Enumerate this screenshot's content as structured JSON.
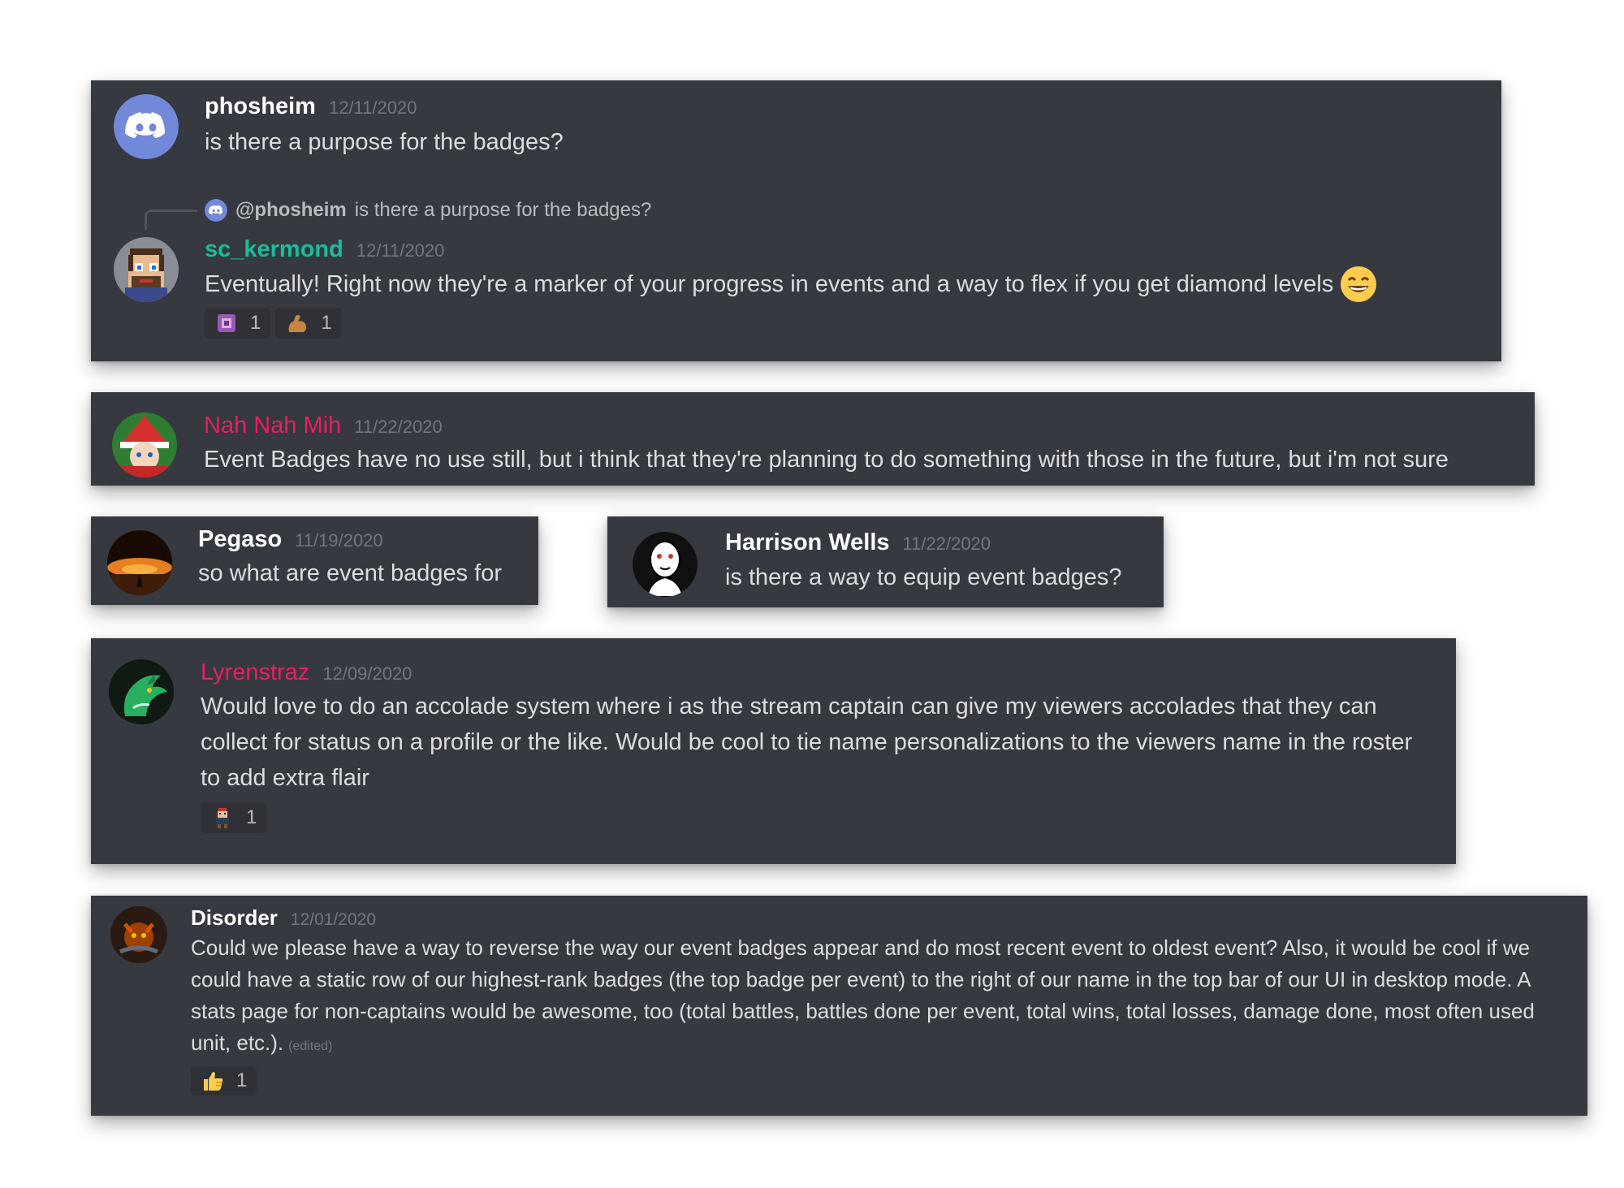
{
  "colors": {
    "card_bg": "#36393f",
    "username_default": "#ffffff",
    "username_teal": "#1abc9c",
    "username_pink": "#e91e63",
    "timestamp": "#72767d",
    "message_text": "#dcddde",
    "blurple": "#7289da"
  },
  "messages": [
    {
      "username": "phosheim",
      "timestamp": "12/11/2020",
      "text": "is there a purpose for the badges?",
      "avatar": "discord-logo-icon"
    },
    {
      "reply_to": {
        "mention": "@phosheim",
        "text": "is there a purpose for the badges?"
      },
      "username": "sc_kermond",
      "timestamp": "12/11/2020",
      "text": "Eventually! Right now they're a marker of your progress in events and a way to flex if you get diamond levels",
      "trailing_emoji": "grinning-face-icon",
      "reactions": [
        {
          "emoji": "badge-icon",
          "count": "1"
        },
        {
          "emoji": "flexed-biceps-icon",
          "count": "1"
        }
      ]
    },
    {
      "username": "Nah Nah Mih",
      "timestamp": "11/22/2020",
      "text": "Event Badges have no use still, but i think that they're planning to do something with those in the future, but i'm not sure"
    },
    {
      "username": "Pegaso",
      "timestamp": "11/19/2020",
      "text": "so what are event badges for"
    },
    {
      "username": "Harrison Wells",
      "timestamp": "11/22/2020",
      "text": "is there a way to equip event badges?"
    },
    {
      "username": "Lyrenstraz",
      "timestamp": "12/09/2020",
      "text": "Would love to do an accolade system where i as the stream captain can give my viewers accolades that they can collect for status on a profile or the like. Would be cool to tie name personalizations to the viewers name in the roster to add extra flair",
      "reactions": [
        {
          "emoji": "pixel-character-icon",
          "count": "1"
        }
      ]
    },
    {
      "username": "Disorder",
      "timestamp": "12/01/2020",
      "text": "Could we please have a way to reverse the way our event badges appear and do most recent event to oldest event? Also, it would be cool if we could have a static row of our highest-rank badges (the top badge per event) to the right of our name in the top bar of our UI in desktop mode. A stats page for non-captains would be awesome, too (total battles, battles done per event, total wins, total losses, damage done, most often used unit, etc.).",
      "edited_label": "(edited)",
      "reactions": [
        {
          "emoji": "thumbs-up-icon",
          "count": "1"
        }
      ]
    }
  ]
}
